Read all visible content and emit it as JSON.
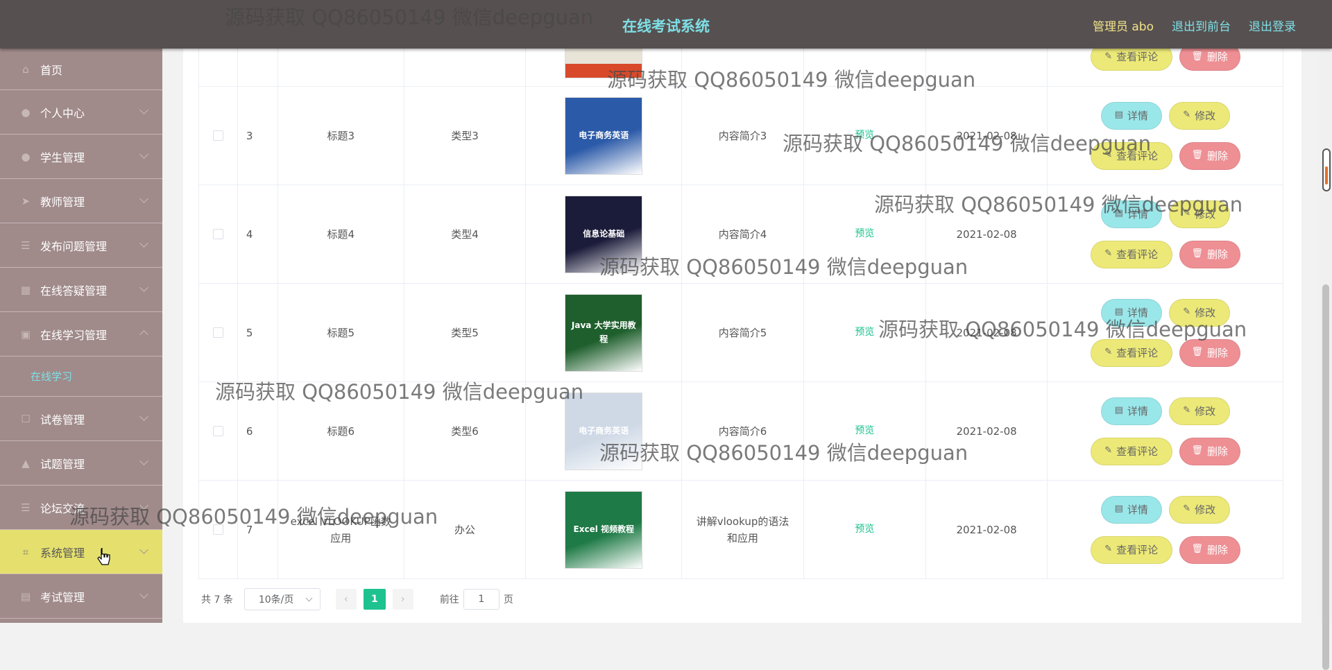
{
  "header": {
    "title": "在线考试系统",
    "user": "管理员 abo",
    "to_front": "退出到前台",
    "logout": "退出登录"
  },
  "sidebar": {
    "items": [
      {
        "label": "首页",
        "icon": "home-icon"
      },
      {
        "label": "个人中心",
        "icon": "user-icon"
      },
      {
        "label": "学生管理",
        "icon": "user-icon"
      },
      {
        "label": "教师管理",
        "icon": "send-icon"
      },
      {
        "label": "发布问题管理",
        "icon": "list-icon"
      },
      {
        "label": "在线答疑管理",
        "icon": "grid-icon"
      },
      {
        "label": "在线学习管理",
        "icon": "calendar-icon"
      },
      {
        "label": "试卷管理",
        "icon": "checkbox-icon"
      },
      {
        "label": "试题管理",
        "icon": "thumb-icon"
      },
      {
        "label": "论坛交流",
        "icon": "list-icon"
      },
      {
        "label": "系统管理",
        "icon": "crop-icon"
      },
      {
        "label": "考试管理",
        "icon": "doc-icon"
      }
    ],
    "sub_item": "在线学习"
  },
  "table": {
    "rows": [
      {
        "id": "3",
        "title": "标题3",
        "type": "类型3",
        "intro": "内容简介3",
        "preview": "预览",
        "date": "2021-02-08",
        "cover_text": "电子商务英语",
        "cover_color": "#2b5aa8"
      },
      {
        "id": "4",
        "title": "标题4",
        "type": "类型4",
        "intro": "内容简介4",
        "preview": "预览",
        "date": "2021-02-08",
        "cover_text": "信息论基础",
        "cover_color": "#1b1b3a"
      },
      {
        "id": "5",
        "title": "标题5",
        "type": "类型5",
        "intro": "内容简介5",
        "preview": "预览",
        "date": "2021-02-08",
        "cover_text": "Java 大学实用教程",
        "cover_color": "#1f5f2d"
      },
      {
        "id": "6",
        "title": "标题6",
        "type": "类型6",
        "intro": "内容简介6",
        "preview": "预览",
        "date": "2021-02-08",
        "cover_text": "电子商务英语",
        "cover_color": "#cfd9e6"
      },
      {
        "id": "7",
        "title": "excel VLOOKUP函数应用",
        "type": "办公",
        "intro": "讲解vlookup的语法和应用",
        "preview": "预览",
        "date": "2021-02-08",
        "cover_text": "Excel 视频教程",
        "cover_color": "#1e7a46"
      }
    ],
    "buttons": {
      "detail": "详情",
      "edit": "修改",
      "comment": "查看评论",
      "delete": "删除"
    }
  },
  "pagination": {
    "total": "共 7 条",
    "page_size": "10条/页",
    "current": "1",
    "goto": "前往",
    "page_input": "1",
    "page_suffix": "页"
  },
  "watermark": "源码获取 QQ86050149 微信deepguan"
}
